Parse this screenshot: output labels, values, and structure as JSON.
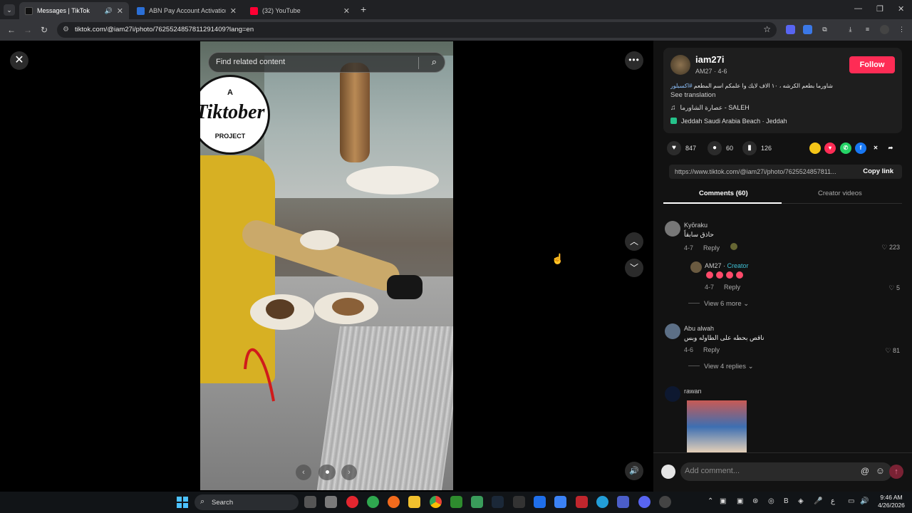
{
  "browser": {
    "tabs": [
      {
        "title": "Messages | TikTok",
        "active": true
      },
      {
        "title": "ABN Pay Account Activation - ",
        "active": false
      },
      {
        "title": "(32) YouTube",
        "active": false
      }
    ],
    "url": "tiktok.com/@iam27i/photo/7625524857811291409?lang=en"
  },
  "viewer": {
    "search_placeholder": "Find related content",
    "logo": {
      "top": "A",
      "word": "Tiktober",
      "bottom": "PROJECT"
    }
  },
  "post": {
    "username": "iam27i",
    "subtitle": "AM27 · 4-6",
    "follow_label": "Follow",
    "caption_text": "شاورما بطعم الكرشه ، ١٠ الاف لايك وا علمكم اسم المطعم",
    "caption_tags": "#اكسبلور #جدة",
    "see_translation": "See translation",
    "music": "عصارة الشاورما - SALEH",
    "location": "Jeddah Saudi Arabia Beach · Jeddah",
    "likes": "847",
    "comments_count": "60",
    "saves": "126",
    "link": "https://www.tiktok.com/@iam27i/photo/7625524857811...",
    "copy_link_label": "Copy link"
  },
  "tabs": {
    "comments_label": "Comments (60)",
    "creator_videos_label": "Creator videos"
  },
  "comments": [
    {
      "name": "Kyōraku",
      "text": "حاذق سابقاً",
      "date": "4-7",
      "reply": "Reply",
      "likes": "223"
    },
    {
      "name": "AM27 · ",
      "badge": "Creator",
      "date": "4-7",
      "reply": "Reply",
      "likes": "5"
    },
    {
      "name": "Abu alwah",
      "text": "ناقص بحطه على الطاوله وبس",
      "date": "4-6",
      "reply": "Reply",
      "likes": "81"
    },
    {
      "name": "rawan"
    }
  ],
  "view_more": [
    "View 6 more",
    "View 4 replies"
  ],
  "composer": {
    "placeholder": "Add comment..."
  },
  "taskbar": {
    "search_label": "Search",
    "time": "9:46 AM",
    "date": "4/26/2026"
  },
  "colors": {
    "accent": "#fe2c55",
    "creator": "#3fc1d6",
    "panel_bg": "#121212"
  }
}
